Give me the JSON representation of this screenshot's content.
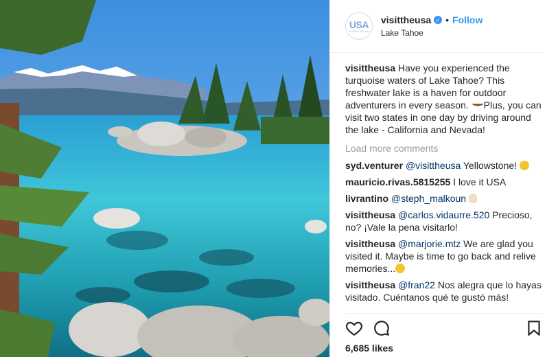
{
  "post": {
    "account": {
      "username": "visittheusa",
      "avatar_text": "USA",
      "avatar_subtext": "VisitTheUSA.com",
      "verified": true,
      "verified_icon": "check-icon",
      "location": "Lake Tahoe"
    },
    "follow_label": "Follow",
    "separator": "•",
    "caption": {
      "user": "visittheusa",
      "text_before_emoji": "Have you experienced the turquoise waters of Lake Tahoe? This freshwater lake is a haven for outdoor adventurers in every season. ",
      "emoji": "canoe-emoji",
      "text_after_emoji": "Plus, you can visit two states in one day by driving around the lake - California and Nevada!"
    },
    "load_more": "Load more comments",
    "comments": [
      {
        "user": "syd.venturer",
        "mention": "@visittheusa",
        "text": " Yellowstone! ",
        "emoji": "smile-emoji"
      },
      {
        "user": "mauricio.rivas.5815255",
        "mention": "",
        "text": "I love it USA",
        "emoji": ""
      },
      {
        "user": "livrantino",
        "mention": "@steph_malkoun",
        "text": " ",
        "emoji": "ok-hand-emoji"
      },
      {
        "user": "visittheusa",
        "mention": "@carlos.vidaurre.520",
        "text": " Precioso, no? ¡Vale la pena visitarlo!",
        "emoji": ""
      },
      {
        "user": "visittheusa",
        "mention": "@marjorie.mtz",
        "text": " We are glad you visited it. Maybe is time to go back and relive memories...",
        "emoji": "wink-emoji"
      },
      {
        "user": "visittheusa",
        "mention": "@fran22",
        "text": " Nos alegra que lo hayas visitado. Cuéntanos qué te gustó más!",
        "emoji": ""
      }
    ],
    "actions": {
      "like_icon": "heart-icon",
      "comment_icon": "comment-icon",
      "save_icon": "bookmark-icon"
    },
    "likes": "6,685 likes",
    "photo_subject": "lake-tahoe-photo"
  }
}
